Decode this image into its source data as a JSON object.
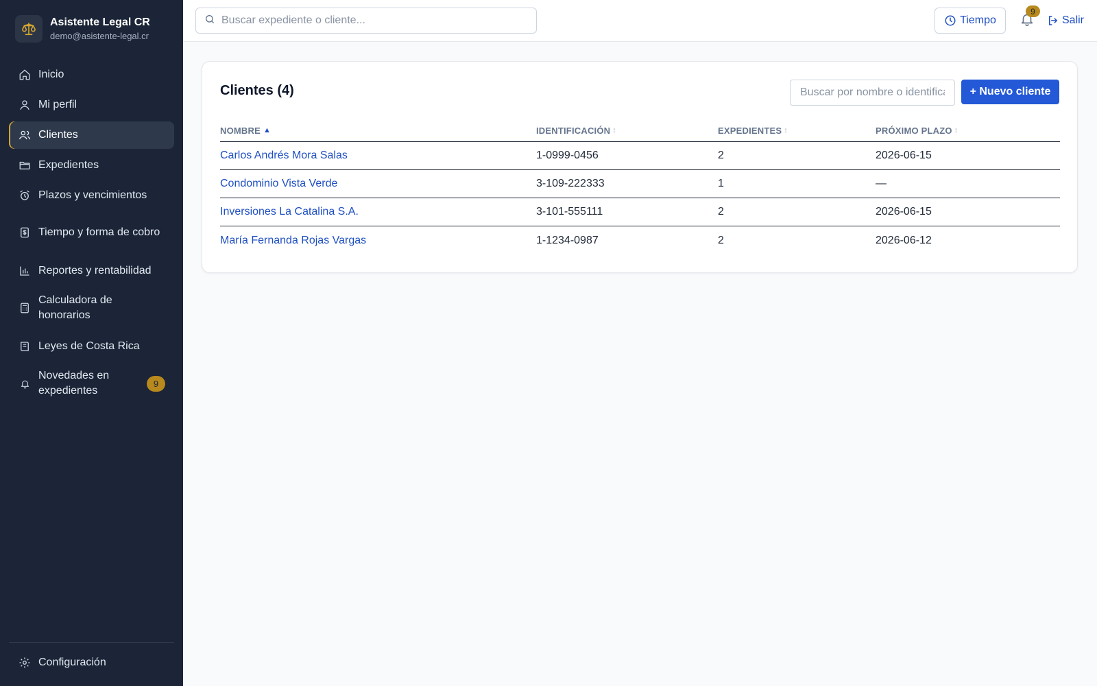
{
  "brand": {
    "title": "Asistente Legal CR",
    "email": "demo@asistente-legal.cr"
  },
  "sidebar": {
    "items": [
      {
        "label": "Inicio",
        "icon": "home-icon"
      },
      {
        "label": "Mi perfil",
        "icon": "user-icon"
      },
      {
        "label": "Clientes",
        "icon": "users-icon",
        "active": true
      },
      {
        "label": "Expedientes",
        "icon": "folder-icon"
      },
      {
        "label": "Plazos y vencimientos",
        "icon": "alarm-clock-icon"
      },
      {
        "label": "Tiempo y forma de cobro",
        "icon": "receipt-icon"
      },
      {
        "label": "Reportes y rentabilidad",
        "icon": "bar-chart-icon"
      },
      {
        "label": "Calculadora de honorarios",
        "icon": "calculator-icon"
      },
      {
        "label": "Leyes de Costa Rica",
        "icon": "book-icon"
      },
      {
        "label": "Novedades en expedientes",
        "icon": "bell-icon",
        "badge": "9"
      }
    ],
    "config_label": "Configuración"
  },
  "topbar": {
    "search_placeholder": "Buscar expediente o cliente...",
    "tiempo_label": "Tiempo",
    "notifications_count": "9",
    "salir_label": "Salir"
  },
  "clients": {
    "title": "Clientes (4)",
    "filter_placeholder": "Buscar por nombre o identificación...",
    "new_button": "+ Nuevo cliente",
    "columns": [
      "NOMBRE",
      "IDENTIFICACIÓN",
      "EXPEDIENTES",
      "PRÓXIMO PLAZO"
    ],
    "sort": {
      "column": "NOMBRE",
      "direction": "asc"
    },
    "rows": [
      {
        "nombre": "Carlos Andrés Mora Salas",
        "identificacion": "1-0999-0456",
        "expedientes": "2",
        "proximo_plazo": "2026-06-15"
      },
      {
        "nombre": "Condominio Vista Verde",
        "identificacion": "3-109-222333",
        "expedientes": "1",
        "proximo_plazo": "—"
      },
      {
        "nombre": "Inversiones La Catalina S.A.",
        "identificacion": "3-101-555111",
        "expedientes": "2",
        "proximo_plazo": "2026-06-15"
      },
      {
        "nombre": "María Fernanda Rojas Vargas",
        "identificacion": "1-1234-0987",
        "expedientes": "2",
        "proximo_plazo": "2026-06-12"
      }
    ]
  },
  "colors": {
    "sidebar_bg": "#1b2537",
    "accent": "#2358d6",
    "badge": "#b8891d",
    "link": "#1e4fc2"
  }
}
